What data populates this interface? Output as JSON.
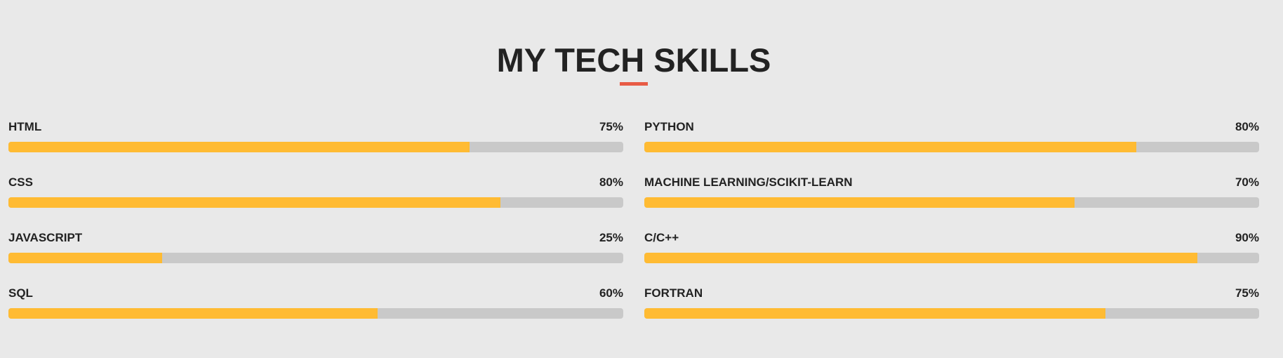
{
  "section": {
    "title": "MY TECH SKILLS",
    "accent_color": "#e85b45",
    "bar_fill_color": "#ffbb33",
    "bar_track_color": "#c9c9c9"
  },
  "skills": [
    {
      "name": "HTML",
      "percent_label": "75%",
      "level": 75
    },
    {
      "name": "PYTHON",
      "percent_label": "80%",
      "level": 80
    },
    {
      "name": "CSS",
      "percent_label": "80%",
      "level": 80
    },
    {
      "name": "MACHINE LEARNING/SCIKIT-LEARN",
      "percent_label": "70%",
      "level": 70
    },
    {
      "name": "JAVASCRIPT",
      "percent_label": "25%",
      "level": 25
    },
    {
      "name": "C/C++",
      "percent_label": "90%",
      "level": 90
    },
    {
      "name": "SQL",
      "percent_label": "60%",
      "level": 60
    },
    {
      "name": "FORTRAN",
      "percent_label": "75%",
      "level": 75
    }
  ]
}
